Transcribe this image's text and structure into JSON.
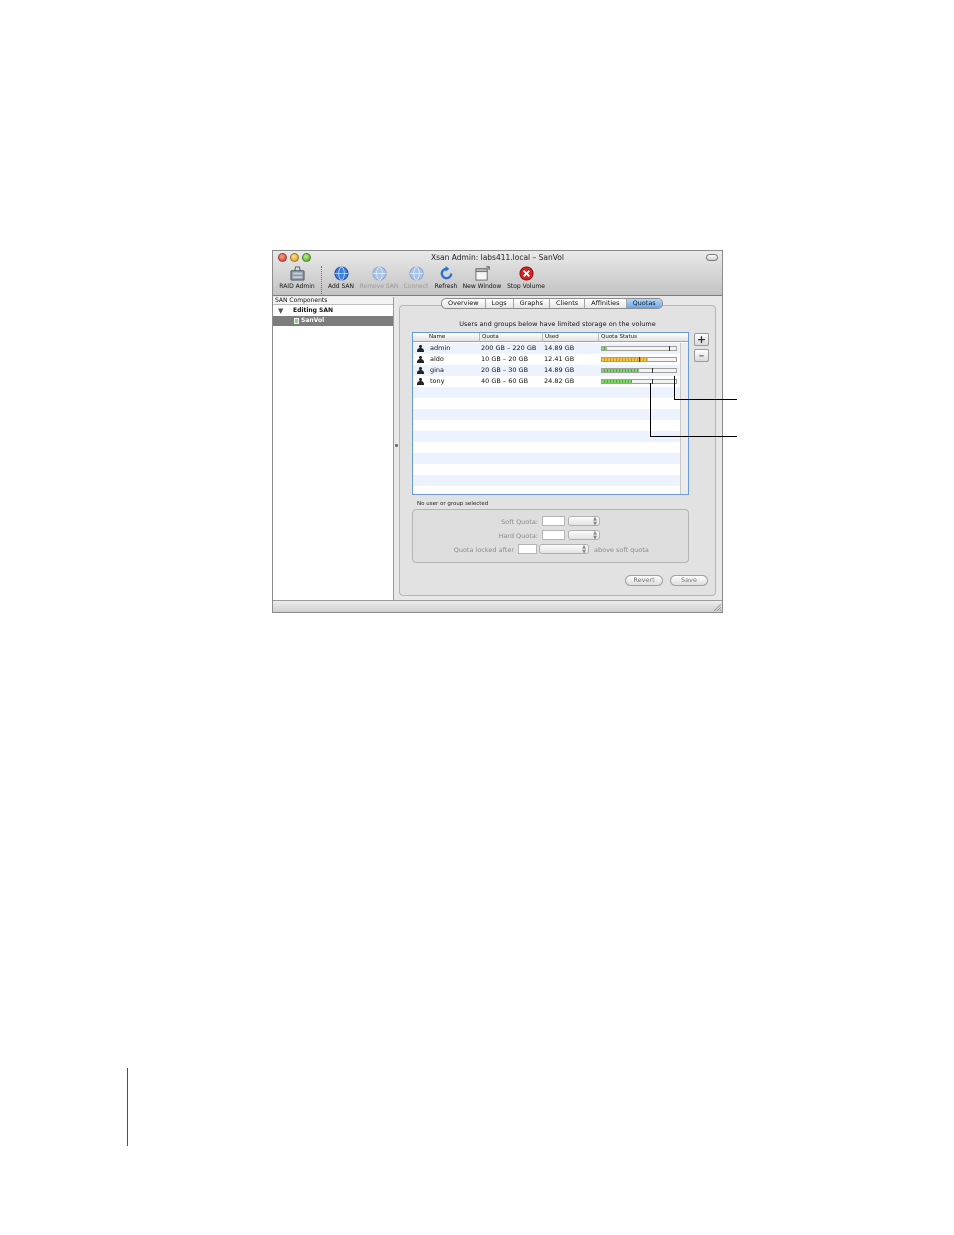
{
  "window": {
    "title": "Xsan Admin: labs411.local – SanVol"
  },
  "toolbar": {
    "items": [
      {
        "label": "RAID Admin",
        "icon": "raid-admin-icon",
        "enabled": true
      },
      {
        "label": "Add SAN",
        "icon": "add-san-globe-icon",
        "enabled": true
      },
      {
        "label": "Remove SAN",
        "icon": "remove-san-globe-icon",
        "enabled": false
      },
      {
        "label": "Connect",
        "icon": "connect-globe-icon",
        "enabled": false
      },
      {
        "label": "Refresh",
        "icon": "refresh-arrow-icon",
        "enabled": true
      },
      {
        "label": "New Window",
        "icon": "new-window-icon",
        "enabled": true
      },
      {
        "label": "Stop Volume",
        "icon": "stop-volume-icon",
        "enabled": true
      }
    ]
  },
  "sidebar": {
    "header": "SAN Components",
    "group": "Editing SAN",
    "selected_item": "SanVol"
  },
  "tabs": [
    "Overview",
    "Logs",
    "Graphs",
    "Clients",
    "Affinities",
    "Quotas"
  ],
  "active_tab": "Quotas",
  "quotas": {
    "info": "Users and groups below have limited storage on the volume",
    "columns": [
      "Name",
      "Quota",
      "Used",
      "Quota Status"
    ],
    "rows": [
      {
        "name": "admin",
        "quota": "200 GB – 220 GB",
        "used": "14.89 GB",
        "status_fraction": 0.07,
        "status_color": "green",
        "soft_mark": 0.91
      },
      {
        "name": "aldo",
        "quota": "10 GB – 20 GB",
        "used": "12.41 GB",
        "status_fraction": 0.62,
        "status_color": "amber",
        "soft_mark": 0.5
      },
      {
        "name": "gina",
        "quota": "20 GB – 30 GB",
        "used": "14.89 GB",
        "status_fraction": 0.5,
        "status_color": "green",
        "soft_mark": 0.67
      },
      {
        "name": "tony",
        "quota": "40 GB – 60 GB",
        "used": "24.82 GB",
        "status_fraction": 0.41,
        "status_color": "green",
        "soft_mark": 0.67
      }
    ],
    "add_label": "+",
    "remove_label": "–"
  },
  "selection_status": "No user or group selected",
  "detail": {
    "soft_quota_label": "Soft Quota:",
    "hard_quota_label": "Hard Quota:",
    "locked_label": "Quota locked after",
    "locked_suffix": "above soft quota",
    "soft_quota_value": "",
    "hard_quota_value": "",
    "locked_value": ""
  },
  "buttons": {
    "revert": "Revert",
    "save": "Save"
  },
  "colors": {
    "tab_active": "#6aa6e6",
    "bar_green": "#4fae3a",
    "bar_amber": "#d69a1a",
    "stop_red": "#d8201f",
    "globe_blue": "#3b7fd8"
  }
}
